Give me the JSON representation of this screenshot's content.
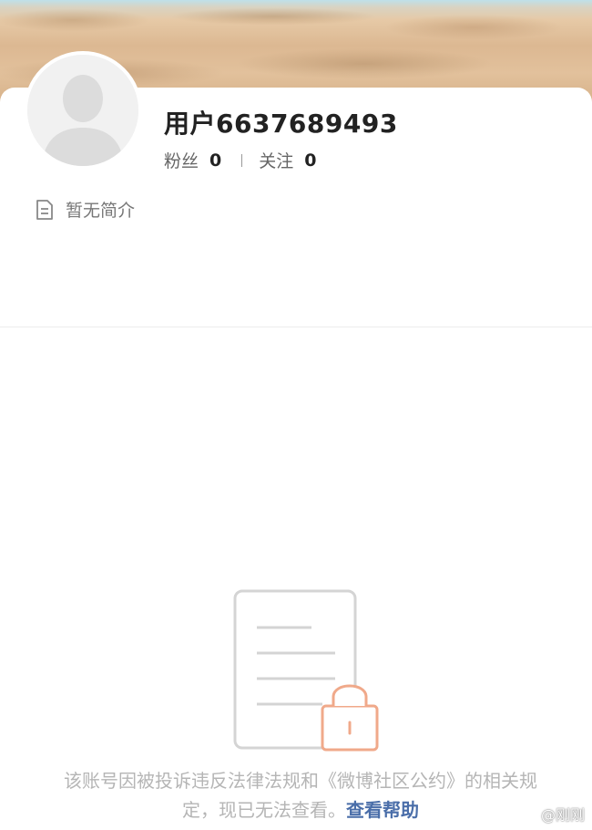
{
  "profile": {
    "username": "用户6637689493",
    "followers_label": "粉丝",
    "followers_count": "0",
    "following_label": "关注",
    "following_count": "0",
    "bio": "暂无简介"
  },
  "notice": {
    "text": "该账号因被投诉违反法律法规和《微博社区公约》的相关规定，现已无法查看。",
    "help_link": "查看帮助"
  },
  "watermark": "@刚刚",
  "icons": {
    "avatar": "default-avatar-icon",
    "bio": "document-icon",
    "empty": "locked-document-icon"
  },
  "colors": {
    "link": "#4a6ea9",
    "lock": "#f0a98a",
    "muted_text": "#b5b5b5"
  }
}
